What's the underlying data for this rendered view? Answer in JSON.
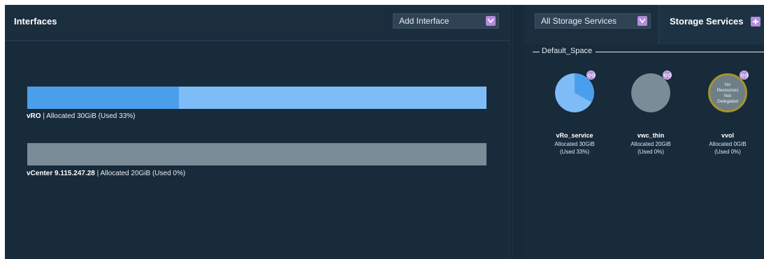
{
  "interfaces": {
    "title": "Interfaces",
    "add_interface": "Add Interface",
    "items": [
      {
        "name": "vRO",
        "allocated": "Allocated 30GiB (Used 33%)",
        "used_fraction": 0.33
      },
      {
        "name": "vCenter 9.115.247.28",
        "allocated": "Allocated 20GiB (Used 0%)",
        "used_fraction": 0.0
      }
    ],
    "separator": "|"
  },
  "storage": {
    "filter": "All Storage Services",
    "title": "Storage Services",
    "space_name": "Default_Space",
    "services": [
      {
        "name": "vRo_service",
        "allocated": "Allocated 30GiB",
        "used": "(Used 33%)",
        "used_fraction": 0.33
      },
      {
        "name": "vwc_thin",
        "allocated": "Allocated 20GiB",
        "used": "(Used 0%)",
        "used_fraction": 0.0
      },
      {
        "name": "vvol",
        "allocated": "Allocated 0GIB",
        "used": "(Used 0%)",
        "used_fraction": 0.0,
        "status_lines": [
          "No",
          "Resources",
          "Not",
          "Delegated"
        ]
      }
    ]
  },
  "colors": {
    "background": "#172a3a",
    "bar_full": "#7ebcf7",
    "bar_used": "#4a9fec",
    "bar_empty": "#7a8c98",
    "accent": "#b48bdc",
    "no_resource_ring": "#a7932a"
  },
  "icons": {
    "dropdown": "chevron-down-icon",
    "add": "plus-icon",
    "link": "link-icon"
  }
}
